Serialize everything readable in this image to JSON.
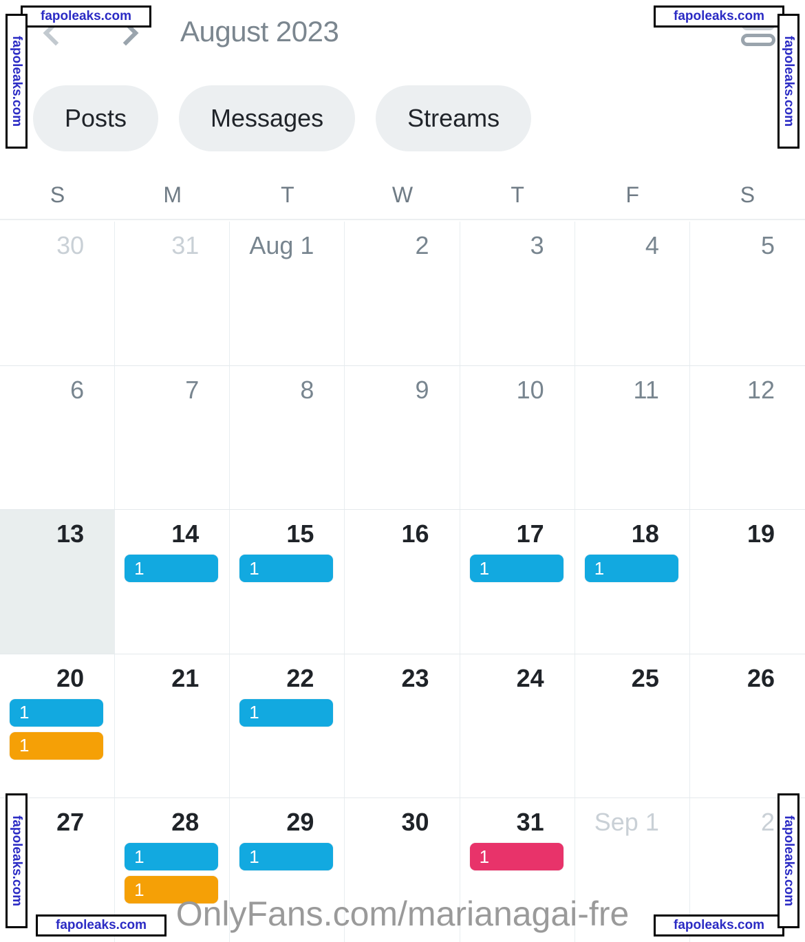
{
  "header": {
    "title": "August 2023",
    "prev_icon": "chevron-left-icon",
    "next_icon": "chevron-right-icon",
    "list_toggle_icon": "list-view-icon"
  },
  "tabs": [
    {
      "label": "Posts"
    },
    {
      "label": "Messages"
    },
    {
      "label": "Streams"
    }
  ],
  "weekdays": [
    "S",
    "M",
    "T",
    "W",
    "T",
    "F",
    "S"
  ],
  "colors": {
    "blue": "#12a9e0",
    "orange": "#f5a006",
    "pink": "#e8336a",
    "tab_bg": "#eceff1",
    "title": "#7b868f",
    "today_bg": "#e9eeee"
  },
  "weeks": [
    {
      "days": [
        {
          "label": "30",
          "state": "muted",
          "events": []
        },
        {
          "label": "31",
          "state": "muted",
          "events": []
        },
        {
          "label": "Aug 1",
          "state": "past",
          "events": []
        },
        {
          "label": "2",
          "state": "past",
          "events": []
        },
        {
          "label": "3",
          "state": "past",
          "events": []
        },
        {
          "label": "4",
          "state": "past",
          "events": []
        },
        {
          "label": "5",
          "state": "past",
          "events": []
        }
      ]
    },
    {
      "days": [
        {
          "label": "6",
          "state": "past",
          "events": []
        },
        {
          "label": "7",
          "state": "past",
          "events": []
        },
        {
          "label": "8",
          "state": "past",
          "events": []
        },
        {
          "label": "9",
          "state": "past",
          "events": []
        },
        {
          "label": "10",
          "state": "past",
          "events": []
        },
        {
          "label": "11",
          "state": "past",
          "events": []
        },
        {
          "label": "12",
          "state": "past",
          "events": []
        }
      ]
    },
    {
      "days": [
        {
          "label": "13",
          "state": "today",
          "events": []
        },
        {
          "label": "14",
          "state": "current",
          "events": [
            {
              "count": "1",
              "color": "blue"
            }
          ]
        },
        {
          "label": "15",
          "state": "current",
          "events": [
            {
              "count": "1",
              "color": "blue"
            }
          ]
        },
        {
          "label": "16",
          "state": "current",
          "events": []
        },
        {
          "label": "17",
          "state": "current",
          "events": [
            {
              "count": "1",
              "color": "blue"
            }
          ]
        },
        {
          "label": "18",
          "state": "current",
          "events": [
            {
              "count": "1",
              "color": "blue"
            }
          ]
        },
        {
          "label": "19",
          "state": "current",
          "events": []
        }
      ]
    },
    {
      "days": [
        {
          "label": "20",
          "state": "current",
          "events": [
            {
              "count": "1",
              "color": "blue"
            },
            {
              "count": "1",
              "color": "orange"
            }
          ]
        },
        {
          "label": "21",
          "state": "current",
          "events": []
        },
        {
          "label": "22",
          "state": "current",
          "events": [
            {
              "count": "1",
              "color": "blue"
            }
          ]
        },
        {
          "label": "23",
          "state": "current",
          "events": []
        },
        {
          "label": "24",
          "state": "current",
          "events": []
        },
        {
          "label": "25",
          "state": "current",
          "events": []
        },
        {
          "label": "26",
          "state": "current",
          "events": []
        }
      ]
    },
    {
      "days": [
        {
          "label": "27",
          "state": "current",
          "events": []
        },
        {
          "label": "28",
          "state": "current",
          "events": [
            {
              "count": "1",
              "color": "blue"
            },
            {
              "count": "1",
              "color": "orange"
            }
          ]
        },
        {
          "label": "29",
          "state": "current",
          "events": [
            {
              "count": "1",
              "color": "blue"
            }
          ]
        },
        {
          "label": "30",
          "state": "current",
          "events": []
        },
        {
          "label": "31",
          "state": "current",
          "events": [
            {
              "count": "1",
              "color": "pink"
            }
          ]
        },
        {
          "label": "Sep 1",
          "state": "muted",
          "events": []
        },
        {
          "label": "2",
          "state": "muted",
          "events": []
        }
      ]
    }
  ],
  "watermarks": {
    "brand": "OnlyFans.com/marianagai-fre",
    "site": "fapoleaks.com"
  }
}
